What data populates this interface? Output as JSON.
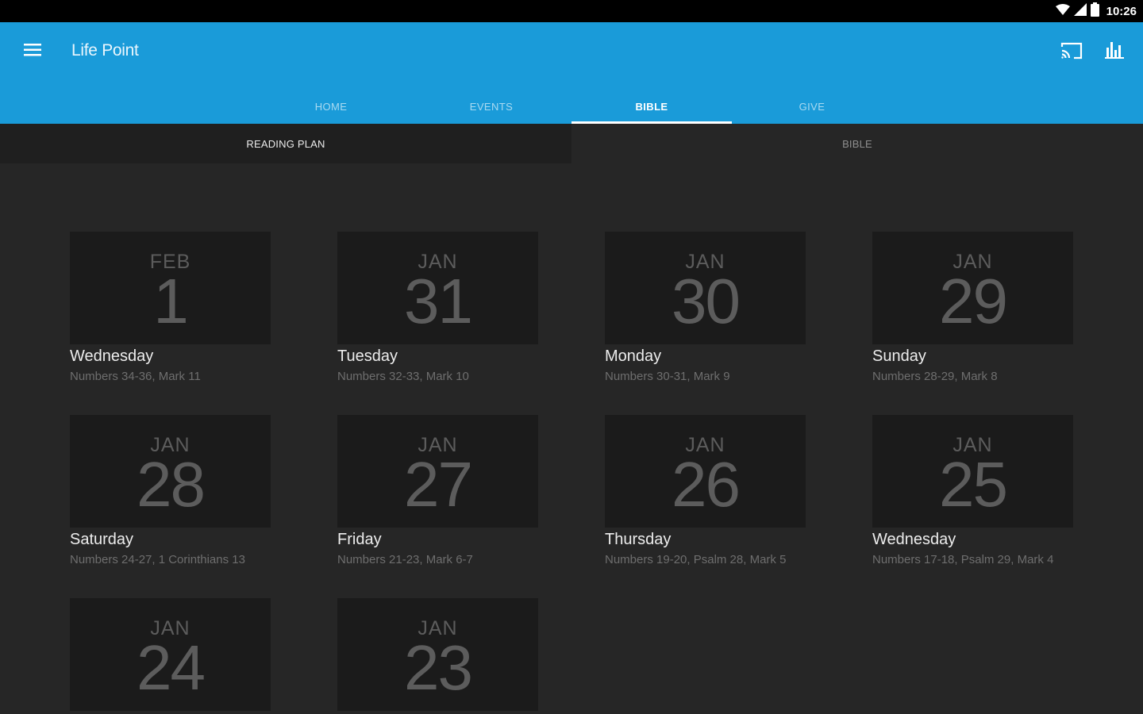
{
  "status_bar": {
    "time": "10:26"
  },
  "app_bar": {
    "title": "Life Point",
    "accent_color": "#1a9bd9"
  },
  "icons": {
    "menu": "menu-icon",
    "cast": "cast-icon",
    "stats": "bar-chart-icon",
    "wifi": "wifi-icon",
    "signal": "signal-icon",
    "battery": "battery-icon"
  },
  "tabs": [
    {
      "label": "HOME",
      "active": false
    },
    {
      "label": "EVENTS",
      "active": false
    },
    {
      "label": "BIBLE",
      "active": true
    },
    {
      "label": "GIVE",
      "active": false
    }
  ],
  "sub_tabs": [
    {
      "label": "READING PLAN",
      "active": true
    },
    {
      "label": "BIBLE",
      "active": false
    }
  ],
  "days": [
    {
      "month": "FEB",
      "day": "1",
      "weekday": "Wednesday",
      "passage": "Numbers 34-36, Mark 11"
    },
    {
      "month": "JAN",
      "day": "31",
      "weekday": "Tuesday",
      "passage": "Numbers 32-33, Mark 10"
    },
    {
      "month": "JAN",
      "day": "30",
      "weekday": "Monday",
      "passage": "Numbers 30-31, Mark 9"
    },
    {
      "month": "JAN",
      "day": "29",
      "weekday": "Sunday",
      "passage": "Numbers 28-29, Mark 8"
    },
    {
      "month": "JAN",
      "day": "28",
      "weekday": "Saturday",
      "passage": "Numbers 24-27, 1 Corinthians 13"
    },
    {
      "month": "JAN",
      "day": "27",
      "weekday": "Friday",
      "passage": "Numbers 21-23, Mark 6-7"
    },
    {
      "month": "JAN",
      "day": "26",
      "weekday": "Thursday",
      "passage": "Numbers 19-20, Psalm 28, Mark 5"
    },
    {
      "month": "JAN",
      "day": "25",
      "weekday": "Wednesday",
      "passage": "Numbers 17-18, Psalm 29, Mark 4"
    },
    {
      "month": "JAN",
      "day": "24",
      "weekday": "",
      "passage": ""
    },
    {
      "month": "JAN",
      "day": "23",
      "weekday": "",
      "passage": ""
    }
  ]
}
